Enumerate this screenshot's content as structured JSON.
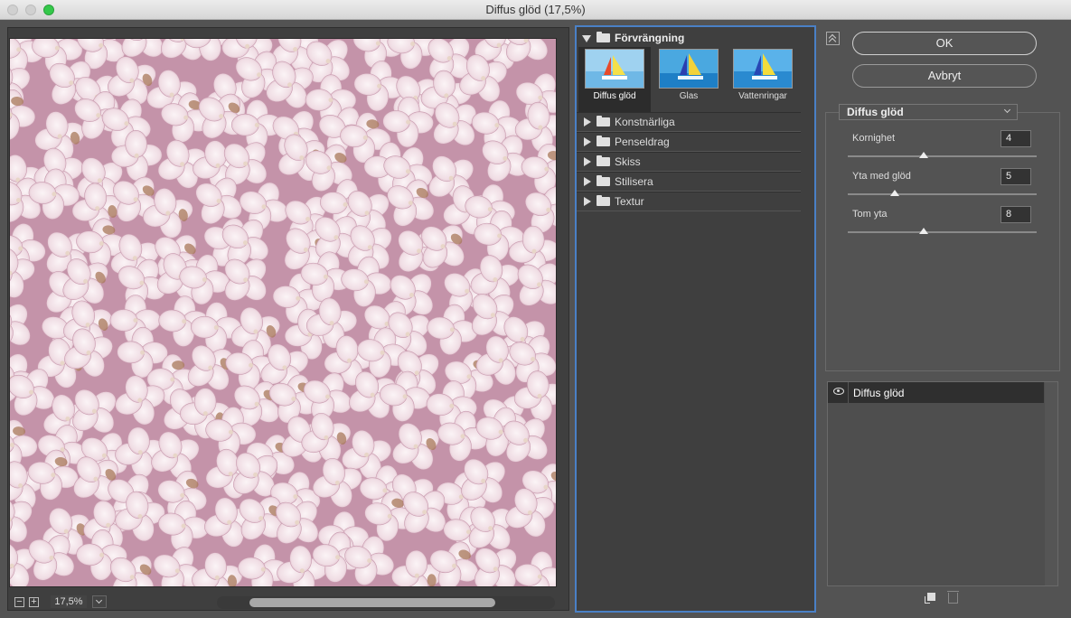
{
  "window": {
    "title": "Diffus glöd (17,5%)"
  },
  "preview": {
    "zoom": "17,5%",
    "zoom_out": "−",
    "zoom_in": "+"
  },
  "gallery": {
    "open_category": "Förvrängning",
    "filters": [
      {
        "label": "Diffus glöd",
        "selected": true
      },
      {
        "label": "Glas",
        "selected": false
      },
      {
        "label": "Vattenringar",
        "selected": false
      }
    ],
    "categories": [
      "Konstnärliga",
      "Penseldrag",
      "Skiss",
      "Stilisera",
      "Textur"
    ]
  },
  "buttons": {
    "ok": "OK",
    "cancel": "Avbryt"
  },
  "settings": {
    "filter": "Diffus glöd",
    "params": [
      {
        "label": "Kornighet",
        "value": "4",
        "fraction": 0.4
      },
      {
        "label": "Yta med glöd",
        "value": "5",
        "fraction": 0.25
      },
      {
        "label": "Tom yta",
        "value": "8",
        "fraction": 0.4
      }
    ]
  },
  "layers": {
    "items": [
      "Diffus glöd"
    ]
  },
  "colors": {
    "accent": "#4a80c6",
    "background": "#535353"
  }
}
